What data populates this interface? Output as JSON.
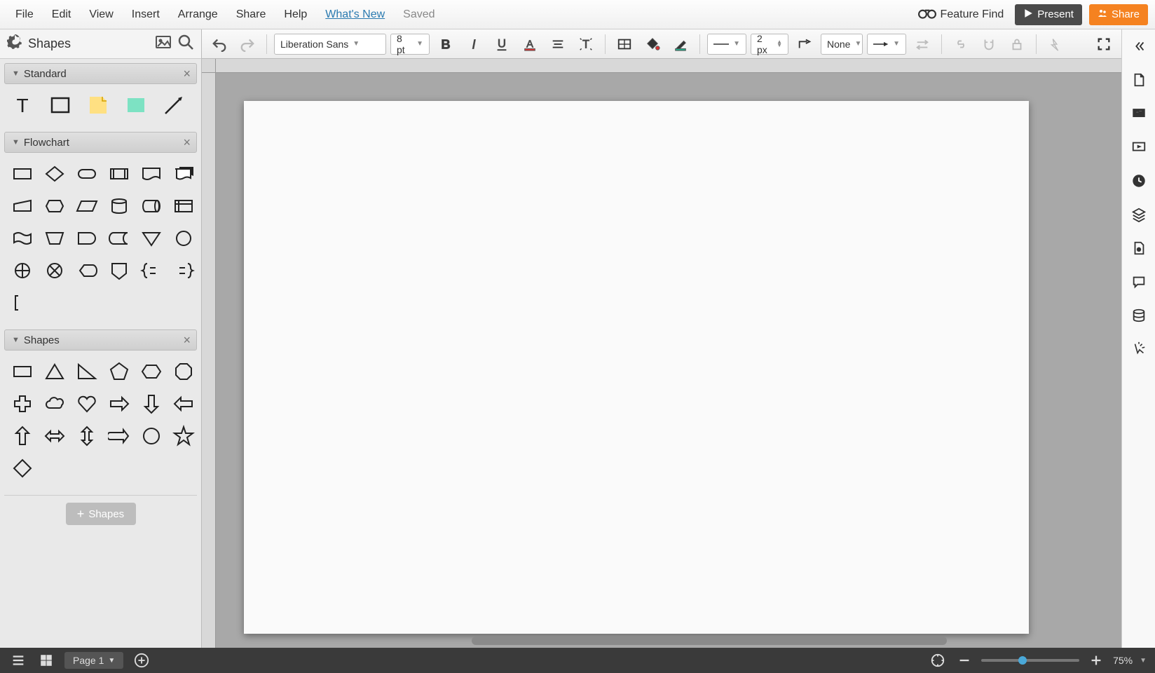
{
  "menubar": {
    "items": [
      "File",
      "Edit",
      "View",
      "Insert",
      "Arrange",
      "Share",
      "Help"
    ],
    "whats_new": "What's New",
    "saved": "Saved",
    "feature_find": "Feature Find",
    "present": "Present",
    "share": "Share"
  },
  "left_panel": {
    "title": "Shapes",
    "sections": {
      "standard": {
        "label": "Standard"
      },
      "flowchart": {
        "label": "Flowchart"
      },
      "shapes": {
        "label": "Shapes"
      }
    },
    "add_shapes": "Shapes"
  },
  "toolbar": {
    "font": "Liberation Sans",
    "font_size": "8 pt",
    "line_width": "2 px",
    "arrow_start": "None"
  },
  "bottombar": {
    "page_label": "Page 1",
    "zoom": "75%"
  }
}
